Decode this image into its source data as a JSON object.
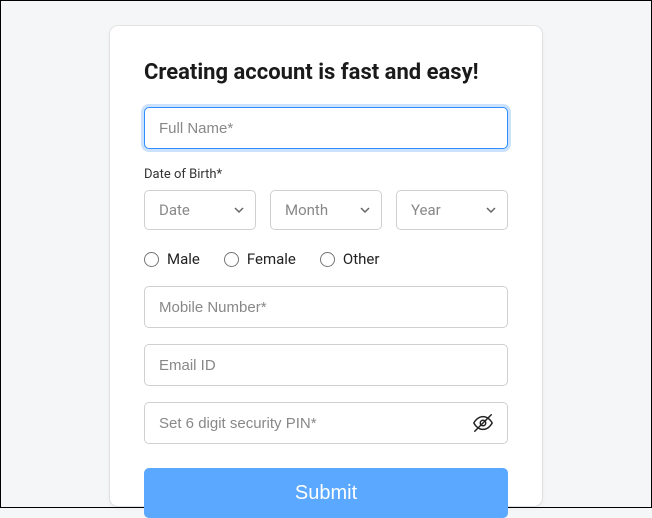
{
  "form": {
    "title": "Creating account is fast and easy!",
    "full_name": {
      "placeholder": "Full Name*",
      "value": ""
    },
    "dob": {
      "label": "Date of Birth*",
      "date_placeholder": "Date",
      "month_placeholder": "Month",
      "year_placeholder": "Year"
    },
    "gender": {
      "options": {
        "male": "Male",
        "female": "Female",
        "other": "Other"
      }
    },
    "mobile": {
      "placeholder": "Mobile Number*",
      "value": ""
    },
    "email": {
      "placeholder": "Email ID",
      "value": ""
    },
    "pin": {
      "placeholder": "Set 6 digit security PIN*",
      "value": ""
    },
    "submit_label": "Submit"
  },
  "colors": {
    "accent": "#5aa8ff",
    "focus": "#2f8dff"
  }
}
